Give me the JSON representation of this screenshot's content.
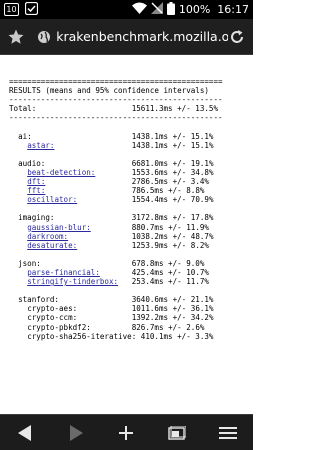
{
  "status_bar": {
    "notification_count": "10",
    "battery": "100%",
    "time": "16:17"
  },
  "browser": {
    "url": "krakenbenchmark.mozilla.org"
  },
  "results": {
    "rule": "===============================================",
    "header": "RESULTS (means and 95% confidence intervals)",
    "dash": "-----------------------------------------------",
    "total_label": "Total:",
    "total_value": "15611.3ms +/- 13.5%",
    "groups": [
      {
        "name": "ai:",
        "value": "1438.1ms +/- 15.1%",
        "tests": [
          {
            "name": "astar:",
            "value": "1438.1ms +/- 15.1%",
            "link": true
          }
        ]
      },
      {
        "name": "audio:",
        "value": "6681.0ms +/- 19.1%",
        "tests": [
          {
            "name": "beat-detection:",
            "value": "1553.6ms +/- 34.8%",
            "link": true
          },
          {
            "name": "dft:",
            "value": "2786.5ms +/- 3.4%",
            "link": true
          },
          {
            "name": "fft:",
            "value": "786.5ms +/- 8.8%",
            "link": true
          },
          {
            "name": "oscillator:",
            "value": "1554.4ms +/- 70.9%",
            "link": true
          }
        ]
      },
      {
        "name": "imaging:",
        "value": "3172.8ms +/- 17.8%",
        "tests": [
          {
            "name": "gaussian-blur:",
            "value": "880.7ms +/- 11.9%",
            "link": true
          },
          {
            "name": "darkroom:",
            "value": "1038.2ms +/- 48.7%",
            "link": true
          },
          {
            "name": "desaturate:",
            "value": "1253.9ms +/- 8.2%",
            "link": true
          }
        ]
      },
      {
        "name": "json:",
        "value": "678.8ms +/- 9.0%",
        "tests": [
          {
            "name": "parse-financial:",
            "value": "425.4ms +/- 10.7%",
            "link": true
          },
          {
            "name": "stringify-tinderbox:",
            "value": "253.4ms +/- 11.7%",
            "link": true
          }
        ]
      },
      {
        "name": "stanford:",
        "value": "3640.6ms +/- 21.1%",
        "tests": [
          {
            "name": "crypto-aes:",
            "value": "1011.6ms +/- 36.1%",
            "link": false
          },
          {
            "name": "crypto-ccm:",
            "value": "1392.2ms +/- 34.2%",
            "link": false
          },
          {
            "name": "crypto-pbkdf2:",
            "value": "826.7ms +/- 2.6%",
            "link": false
          },
          {
            "name": "crypto-sha256-iterative:",
            "value": "410.1ms +/- 3.3%",
            "link": false
          }
        ]
      }
    ]
  },
  "icons": {
    "status_left": [
      "notification-count-icon",
      "check-icon"
    ],
    "status_right": [
      "wifi-icon",
      "no-sim-icon",
      "battery-icon"
    ],
    "urlbar": [
      "star-icon",
      "globe-icon",
      "reload-icon"
    ],
    "navbar": [
      "back-icon",
      "forward-icon",
      "new-tab-icon",
      "tabs-icon",
      "menu-icon"
    ]
  },
  "colors": {
    "link": "#2a2a9e",
    "chrome_dark": "#1f1f1f",
    "status_bar": "#000000"
  }
}
